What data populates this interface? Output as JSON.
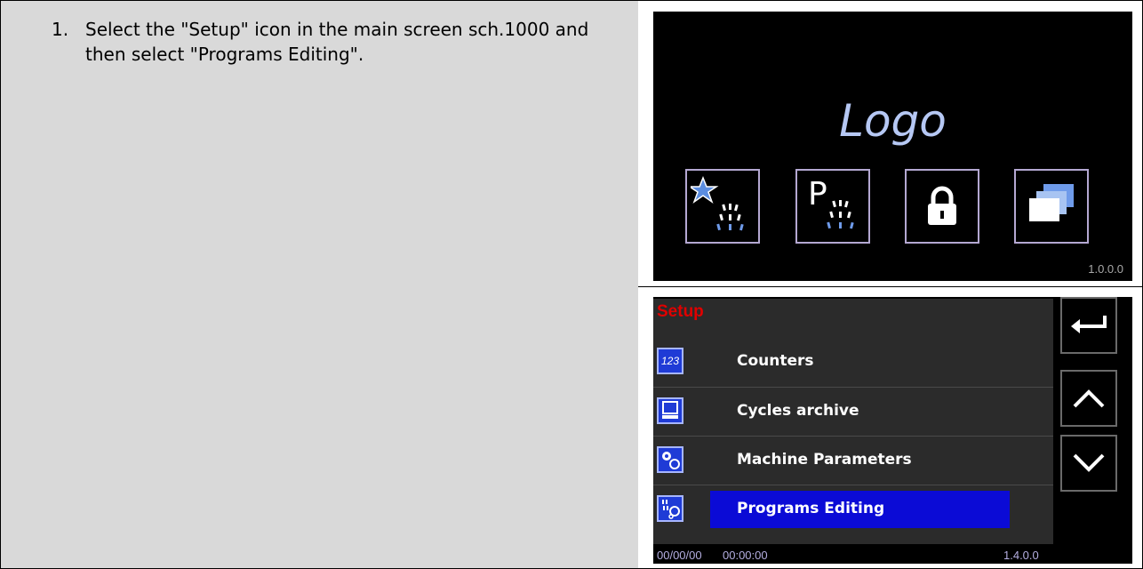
{
  "instruction": {
    "number": "1.",
    "text": "Select the \"Setup\" icon in the main screen sch.1000 and then select \"Programs Editing\"."
  },
  "main_screen": {
    "logo": "Logo",
    "icons": [
      "favorite-program-icon",
      "program-icon",
      "lock-icon",
      "setup-icon"
    ],
    "icon_p_letter": "P",
    "version": "1.0.0.0"
  },
  "setup_screen": {
    "title": "Setup",
    "items": [
      {
        "label": "Counters",
        "icon": "counter-icon",
        "icon_text": "123"
      },
      {
        "label": "Cycles archive",
        "icon": "archive-icon"
      },
      {
        "label": "Machine Parameters",
        "icon": "gears-icon"
      },
      {
        "label": "Programs Editing",
        "icon": "program-edit-icon",
        "selected": true
      }
    ],
    "nav": [
      "back-icon",
      "up-arrow-icon",
      "down-arrow-icon"
    ],
    "status": {
      "date": "00/00/00",
      "time": "00:00:00",
      "version": "1.4.0.0"
    }
  },
  "colors": {
    "panel_bg": "#2b2b2b",
    "title_red": "#e00000",
    "highlight_blue": "#0b0bd6",
    "logo_blue": "#b6c8f4"
  }
}
